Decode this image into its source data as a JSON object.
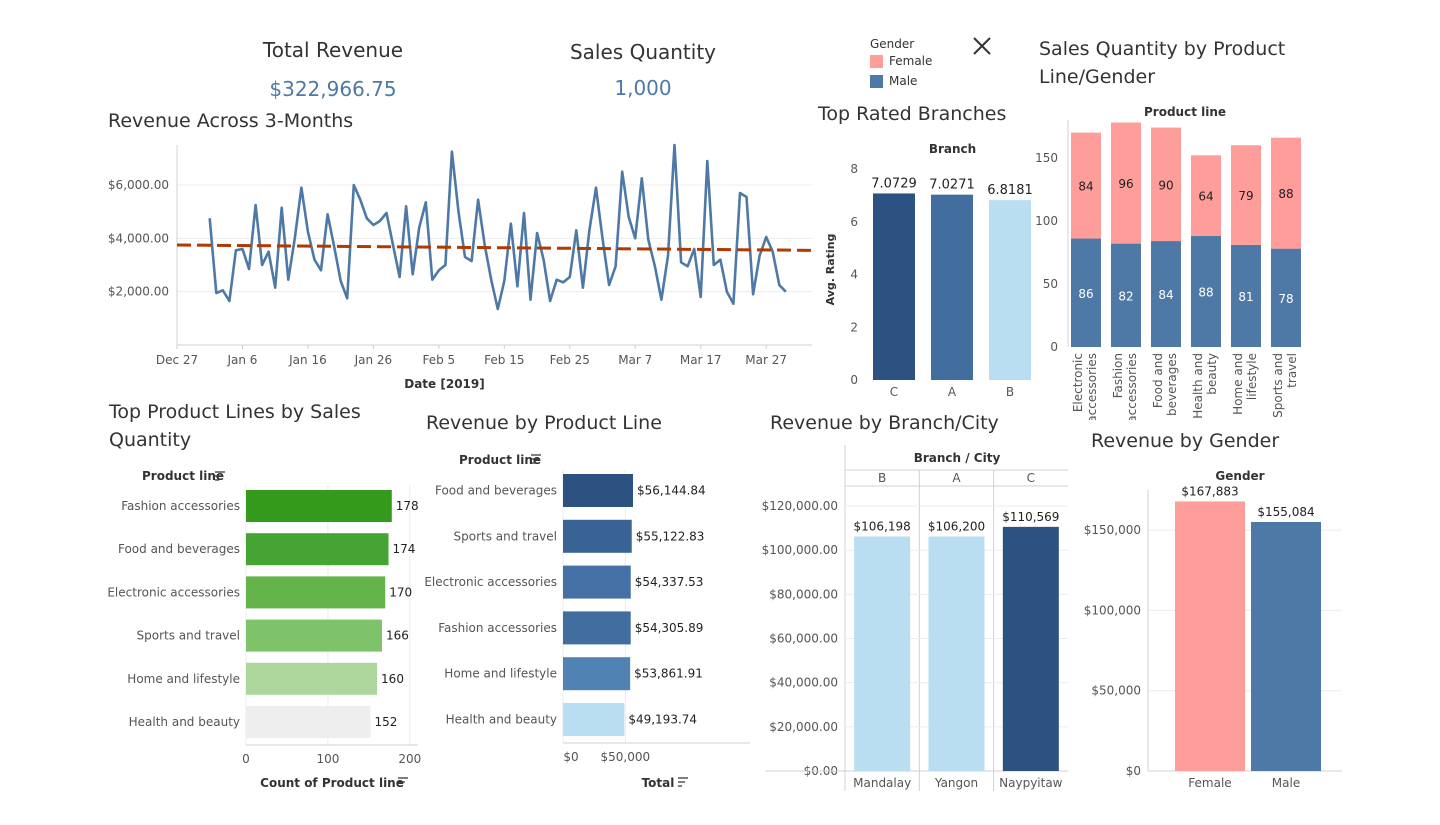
{
  "kpis": {
    "total_revenue": {
      "title": "Total Revenue",
      "value": "$322,966.75"
    },
    "sales_quantity": {
      "title": "Sales Quantity",
      "value": "1,000"
    }
  },
  "legend": {
    "title": "Gender",
    "items": [
      {
        "label": "Female",
        "color": "#ff9d9a"
      },
      {
        "label": "Male",
        "color": "#4e79a7"
      }
    ]
  },
  "titles": {
    "revenue_trend": "Revenue Across 3-Months",
    "top_branches": "Top Rated Branches",
    "qty_by_line_gender": "Sales Quantity by Product Line/Gender",
    "top_lines_qty": "Top Product Lines by Sales Quantity",
    "revenue_by_line": "Revenue by Product Line",
    "revenue_by_branch": "Revenue by Branch/City",
    "revenue_by_gender": "Revenue by Gender"
  },
  "chart_data": [
    {
      "id": "revenue_trend",
      "type": "line",
      "title": "Revenue Across 3-Months",
      "xlabel": "Date [2019]",
      "ylabel": "",
      "x_ticks": [
        "Dec 27",
        "Jan 6",
        "Jan 16",
        "Jan 26",
        "Feb 5",
        "Feb 15",
        "Feb 25",
        "Mar 7",
        "Mar 17",
        "Mar 27"
      ],
      "y_ticks": [
        "$2,000.00",
        "$4,000.00",
        "$6,000.00"
      ],
      "ylim": [
        0,
        7500
      ],
      "x": [
        "2019-01-01",
        "2019-01-02",
        "2019-01-03",
        "2019-01-04",
        "2019-01-05",
        "2019-01-06",
        "2019-01-07",
        "2019-01-08",
        "2019-01-09",
        "2019-01-10",
        "2019-01-11",
        "2019-01-12",
        "2019-01-13",
        "2019-01-14",
        "2019-01-15",
        "2019-01-16",
        "2019-01-17",
        "2019-01-18",
        "2019-01-19",
        "2019-01-20",
        "2019-01-21",
        "2019-01-22",
        "2019-01-23",
        "2019-01-24",
        "2019-01-25",
        "2019-01-26",
        "2019-01-27",
        "2019-01-28",
        "2019-01-29",
        "2019-01-30",
        "2019-01-31",
        "2019-02-01",
        "2019-02-02",
        "2019-02-03",
        "2019-02-04",
        "2019-02-05",
        "2019-02-06",
        "2019-02-07",
        "2019-02-08",
        "2019-02-09",
        "2019-02-10",
        "2019-02-11",
        "2019-02-12",
        "2019-02-13",
        "2019-02-14",
        "2019-02-15",
        "2019-02-16",
        "2019-02-17",
        "2019-02-18",
        "2019-02-19",
        "2019-02-20",
        "2019-02-21",
        "2019-02-22",
        "2019-02-23",
        "2019-02-24",
        "2019-02-25",
        "2019-02-26",
        "2019-02-27",
        "2019-02-28",
        "2019-03-01",
        "2019-03-02",
        "2019-03-03",
        "2019-03-04",
        "2019-03-05",
        "2019-03-06",
        "2019-03-07",
        "2019-03-08",
        "2019-03-09",
        "2019-03-10",
        "2019-03-11",
        "2019-03-12",
        "2019-03-13",
        "2019-03-14",
        "2019-03-15",
        "2019-03-16",
        "2019-03-17",
        "2019-03-18",
        "2019-03-19",
        "2019-03-20",
        "2019-03-21",
        "2019-03-22",
        "2019-03-23",
        "2019-03-24",
        "2019-03-25",
        "2019-03-26",
        "2019-03-27",
        "2019-03-28",
        "2019-03-29",
        "2019-03-30"
      ],
      "series": [
        {
          "values": [
            4750,
            1950,
            2050,
            1650,
            3550,
            3600,
            2850,
            5250,
            3000,
            3500,
            2150,
            5150,
            2450,
            4000,
            5900,
            4250,
            3200,
            2800,
            4900,
            3700,
            2400,
            1750,
            6000,
            5450,
            4750,
            4500,
            4650,
            4950,
            3750,
            2550,
            5200,
            2650,
            4400,
            5350,
            2450,
            2800,
            3000,
            7250,
            5000,
            3300,
            3150,
            5450,
            3750,
            2450,
            1350,
            2400,
            4550,
            2200,
            4950,
            1700,
            4200,
            3200,
            1650,
            2450,
            2350,
            2550,
            4300,
            2150,
            4300,
            5900,
            4000,
            2250,
            2950,
            6500,
            4800,
            4000,
            6250,
            3950,
            2950,
            1700,
            3350,
            7500,
            3100,
            2950,
            3600,
            1800,
            6900,
            3000,
            3200,
            2000,
            1550,
            5700,
            5550,
            1900,
            3350,
            4050,
            3500,
            2250,
            2000,
            2850,
            2200,
            4100,
            4450
          ]
        }
      ],
      "trend": {
        "start": 3750,
        "end": 3550,
        "color": "#b03a00"
      }
    },
    {
      "id": "top_branches",
      "type": "bar",
      "title": "Top Rated Branches",
      "header": "Branch",
      "categories": [
        "C",
        "A",
        "B"
      ],
      "values": [
        7.0729,
        7.0271,
        6.8181
      ],
      "labels": [
        "7.0729",
        "7.0271",
        "6.8181"
      ],
      "colors": [
        "#2c5282",
        "#416e9f",
        "#b9ddf1"
      ],
      "ylabel": "Avg. Rating",
      "ylim": [
        0,
        8
      ],
      "y_ticks": [
        "0",
        "2",
        "4",
        "6",
        "8"
      ]
    },
    {
      "id": "qty_by_line_gender",
      "type": "bar",
      "title": "Sales Quantity by Product Line/Gender",
      "header": "Product line",
      "categories": [
        [
          "Electronic",
          "accessories"
        ],
        [
          "Fashion",
          "accessories"
        ],
        [
          "Food and",
          "beverages"
        ],
        [
          "Health and",
          "beauty"
        ],
        [
          "Home and",
          "lifestyle"
        ],
        [
          "Sports and",
          "travel"
        ]
      ],
      "series": [
        {
          "name": "Male",
          "values": [
            86,
            82,
            84,
            88,
            81,
            78
          ]
        },
        {
          "name": "Female",
          "values": [
            84,
            96,
            90,
            64,
            79,
            88
          ]
        }
      ],
      "ylim": [
        0,
        180
      ],
      "y_ticks": [
        "0",
        "50",
        "100",
        "150"
      ]
    },
    {
      "id": "top_lines_qty",
      "type": "bar",
      "title": "Top Product Lines by Sales Quantity",
      "header": "Product line",
      "categories": [
        "Fashion accessories",
        "Food and beverages",
        "Electronic accessories",
        "Sports and travel",
        "Home and lifestyle",
        "Health and beauty"
      ],
      "values": [
        178,
        174,
        170,
        166,
        160,
        152
      ],
      "labels": [
        "178",
        "174",
        "170",
        "166",
        "160",
        "152"
      ],
      "colors": [
        "#339a1c",
        "#45a434",
        "#64b44b",
        "#7ec36a",
        "#acd69c",
        "#eeeeee"
      ],
      "xlabel": "Count of Product line",
      "xlim": [
        0,
        210
      ],
      "x_ticks": [
        "0",
        "100",
        "200"
      ]
    },
    {
      "id": "revenue_by_line",
      "type": "bar",
      "title": "Revenue by Product Line",
      "header": "Product line",
      "categories": [
        "Food and beverages",
        "Sports and travel",
        "Electronic accessories",
        "Fashion accessories",
        "Home and lifestyle",
        "Health and beauty"
      ],
      "values": [
        56144.84,
        55122.83,
        54337.53,
        54305.89,
        53861.91,
        49193.74
      ],
      "labels": [
        "$56,144.84",
        "$55,122.83",
        "$54,337.53",
        "$54,305.89",
        "$53,861.91",
        "$49,193.74"
      ],
      "colors": [
        "#2c5282",
        "#386394",
        "#4571a6",
        "#416e9f",
        "#5083b4",
        "#b9ddf1"
      ],
      "xlabel": "Total",
      "xlim": [
        0,
        150000
      ],
      "x_ticks": [
        "$0",
        "$50,000"
      ]
    },
    {
      "id": "revenue_by_branch",
      "type": "bar",
      "title": "Revenue by Branch/City",
      "header": "Branch / City",
      "branches": [
        "B",
        "A",
        "C"
      ],
      "categories": [
        "Mandalay",
        "Yangon",
        "Naypyitaw"
      ],
      "values": [
        106198,
        106200,
        110569
      ],
      "labels": [
        "$106,198",
        "$106,200",
        "$110,569"
      ],
      "colors": [
        "#b9ddf1",
        "#b9ddf1",
        "#2c5282"
      ],
      "ylim": [
        0,
        125000
      ],
      "y_ticks": [
        "$0.00",
        "$20,000.00",
        "$40,000.00",
        "$60,000.00",
        "$80,000.00",
        "$100,000.00",
        "$120,000.00"
      ]
    },
    {
      "id": "revenue_by_gender",
      "type": "bar",
      "title": "Revenue by Gender",
      "header": "Gender",
      "categories": [
        "Female",
        "Male"
      ],
      "values": [
        167883,
        155084
      ],
      "labels": [
        "$167,883",
        "$155,084"
      ],
      "colors": [
        "#ff9d9a",
        "#4e79a7"
      ],
      "ylim": [
        0,
        175000
      ],
      "y_ticks": [
        "$0",
        "$50,000",
        "$100,000",
        "$150,000"
      ]
    }
  ]
}
